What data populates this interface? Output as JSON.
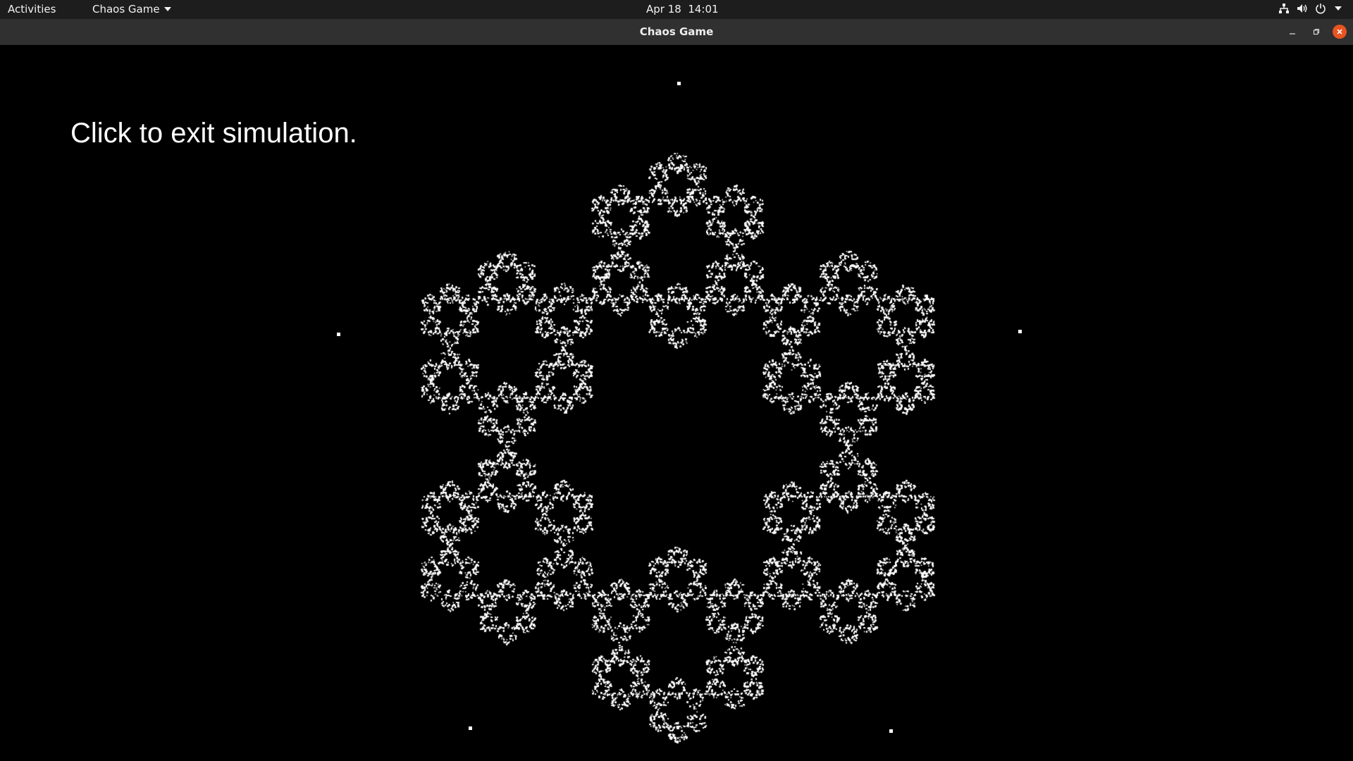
{
  "topbar": {
    "activities_label": "Activities",
    "app_menu_label": "Chaos Game",
    "clock": "Apr 18  14:01",
    "status_icons": [
      "network-icon",
      "volume-icon",
      "power-icon"
    ]
  },
  "window": {
    "title": "Chaos Game"
  },
  "simulation": {
    "exit_text": "Click to exit simulation.",
    "vertex_count": 6,
    "point_color": "#ffffff",
    "background_color": "#000000"
  },
  "colors": {
    "close_button": "#e95420",
    "titlebar": "#303030",
    "topbar": "#1d1d1d"
  }
}
